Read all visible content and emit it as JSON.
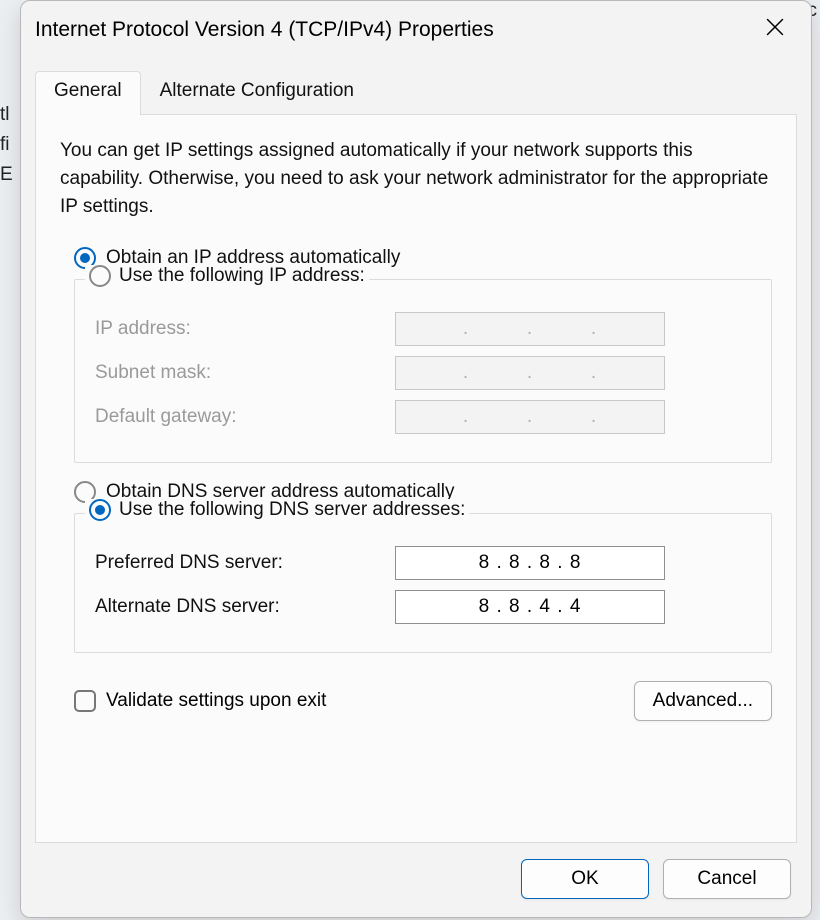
{
  "dialog": {
    "title": "Internet Protocol Version 4 (TCP/IPv4) Properties"
  },
  "tabs": {
    "general": "General",
    "alternate": "Alternate Configuration"
  },
  "description": "You can get IP settings assigned automatically if your network supports this capability. Otherwise, you need to ask your network administrator for the appropriate IP settings.",
  "ip": {
    "auto_label": "Obtain an IP address automatically",
    "manual_label": "Use the following IP address:",
    "selected": "auto",
    "fields": {
      "address_label": "IP address:",
      "address_value": "",
      "subnet_label": "Subnet mask:",
      "subnet_value": "",
      "gateway_label": "Default gateway:",
      "gateway_value": ""
    }
  },
  "dns": {
    "auto_label": "Obtain DNS server address automatically",
    "manual_label": "Use the following DNS server addresses:",
    "selected": "manual",
    "fields": {
      "preferred_label": "Preferred DNS server:",
      "preferred_value": "8 . 8 . 8 . 8",
      "alternate_label": "Alternate DNS server:",
      "alternate_value": "8 . 8 . 4 . 4"
    }
  },
  "validate_label": "Validate settings upon exit",
  "validate_checked": false,
  "buttons": {
    "advanced": "Advanced...",
    "ok": "OK",
    "cancel": "Cancel"
  },
  "glyphs": {
    "ip_dot_sep": "."
  }
}
